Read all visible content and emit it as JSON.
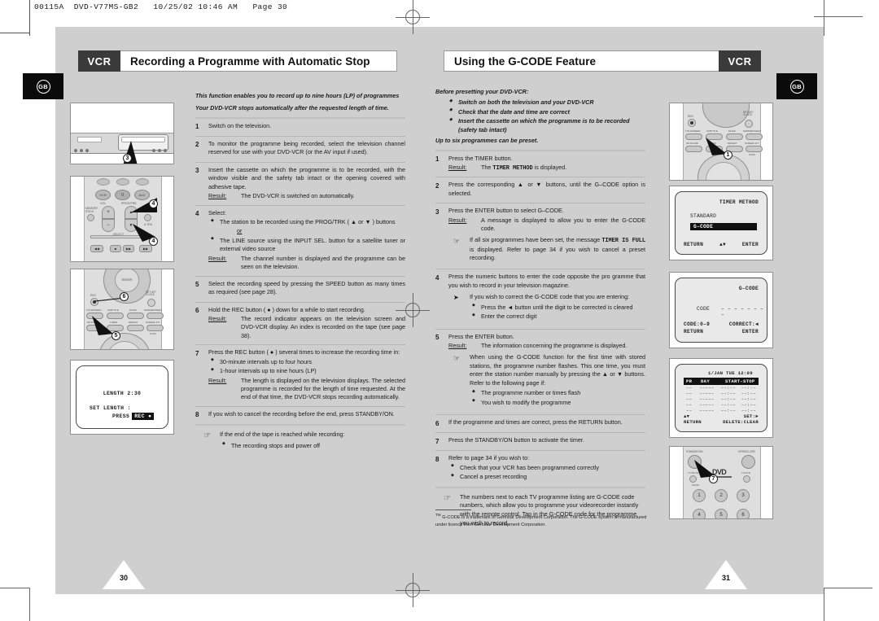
{
  "print_header": {
    "file_line": "00115A  DVD-V77MS-GB2   10/25/02 10:46 AM   Page 30"
  },
  "language_badge": "GB",
  "left_page": {
    "page_number": "30",
    "titlebar": {
      "badge": "VCR",
      "title": "Recording a Programme with Automatic Stop"
    },
    "intro": [
      "This function enables you to record up to nine hours (LP) of programmes",
      "Your DVD-VCR stops automatically after the requested length of time."
    ],
    "steps": [
      {
        "num": "1",
        "lines": [
          "Switch on the television."
        ]
      },
      {
        "num": "2",
        "lines": [
          "To monitor the programme being recorded, select the television channel reserved for use with your DVD-VCR (or the AV input if used)."
        ]
      },
      {
        "num": "3",
        "lines": [
          "Insert the cassette on which the programme is to be recorded, with the window visible and the safety tab intact or the opening covered with adhesive tape."
        ],
        "result": {
          "label": "Result:",
          "text": "The DVD-VCR is switched on automatically."
        }
      },
      {
        "num": "4",
        "lines": [
          "Select:"
        ],
        "bullets": [
          "The station to be recorded using the PROG/TRK ( ▲ or ▼ ) buttons"
        ],
        "or_text": "or",
        "bullets2": [
          "The LINE source using the INPUT SEL. button for a satellite tuner or external video source"
        ],
        "result": {
          "label": "Result:",
          "text": "The channel number is displayed and the programme can be seen on the television."
        }
      },
      {
        "num": "5",
        "lines": [
          "Select the recording speed by pressing the SPEED button as many times as required (see page 28)."
        ]
      },
      {
        "num": "6",
        "lines": [
          "Hold the REC button ( ● ) down for a while to start recording."
        ],
        "result": {
          "label": "Result:",
          "text": "The record indicator appears on the television screen and DVD-VCR display. An index is recorded on the tape (see page 38)."
        }
      },
      {
        "num": "7",
        "lines": [
          "Press the REC button ( ● ) several times to increase the recording time in:"
        ],
        "bullets": [
          "30-minute intervals up to four hours",
          "1-hour intervals up to nine hours (LP)"
        ],
        "result": {
          "label": "Result:",
          "text": "The length is displayed on the television displays. The selected programme is recorded for the length of time requested. At the end of that time, the DVD-VCR stops recording automatically."
        }
      },
      {
        "num": "8",
        "lines": [
          "If you wish to cancel the recording before the end, press STANDBY/ON."
        ]
      }
    ],
    "final_note": {
      "icon": "pointing-hand-icon",
      "text": "If the end of the tape is reached while recording:",
      "bullets": [
        "The recording stops and power off"
      ]
    },
    "illustrations": {
      "deck": {
        "name": "dvd-vcr-deck-illustration",
        "callout": "3"
      },
      "remote_prog": {
        "name": "remote-prog-trk-illustration",
        "callouts": [
          "4",
          "4"
        ],
        "labels": [
          "VOL",
          "PROG/TRK",
          "MEMORY STICK",
          "INPUT SEL.",
          "A.TRK",
          "SELECT",
          "VCR",
          "0",
          "AUX"
        ]
      },
      "remote_rec": {
        "name": "remote-rec-speed-illustration",
        "callouts": [
          "6",
          "5"
        ],
        "labels": [
          "ENTER",
          "REC",
          "SET UP/CLOCK",
          "TITLE/SPEED",
          "SUBTITLE",
          "MODE",
          "MARKER/INDEX",
          "3D SOUND",
          "TIMER",
          "REPEAT",
          "SCREEN FIT",
          "SVHS"
        ]
      },
      "osd_length": {
        "name": "osd-length-screen",
        "line1": "LENGTH 2:30",
        "line2": "SET LENGTH :",
        "line3_pre": "PRESS",
        "line3_key": "REC ●"
      }
    }
  },
  "right_page": {
    "page_number": "31",
    "titlebar": {
      "badge": "VCR",
      "title": "Using the G-CODE  Feature"
    },
    "intro_heading": "Before presetting your DVD-VCR:",
    "intro_bullets": [
      "Switch on both the television and your DVD-VCR",
      "Check that the date and time are correct",
      "Insert the cassette on which the programme is to be recorded (safety tab intact)"
    ],
    "intro_tail": "Up to six programmes can be preset.",
    "steps": [
      {
        "num": "1",
        "lines": [
          "Press the TIMER button."
        ],
        "result": {
          "label": "Result:",
          "text_pre": "The ",
          "mono": "TIMER METHOD",
          "text_post": " is displayed."
        }
      },
      {
        "num": "2",
        "lines": [
          "Press the corresponding ▲ or ▼ buttons, until the G–CODE option is selected."
        ]
      },
      {
        "num": "3",
        "lines": [
          "Press the ENTER button to select G–CODE."
        ],
        "result": {
          "label": "Result:",
          "text": "A message is displayed to allow you to enter the G-CODE code."
        },
        "note": {
          "icon": "pointing-hand-icon",
          "text_pre": "If all six programmes have been set, the message ",
          "mono": "TIMER IS FULL",
          "text_post": " is displayed. Refer to page 34 if you wish to cancel a preset recording."
        }
      },
      {
        "num": "4",
        "lines": [
          "Press the numeric buttons to enter the code opposite the pro gramme that you wish to record in your television magazine."
        ],
        "note2": {
          "icon": "arrow-bullet-icon",
          "text": "If you wish to correct the G-CODE code that you are entering:",
          "bullets": [
            "Press the ◄ button until the digit to be corrected is cleared",
            "Enter the correct digit"
          ]
        }
      },
      {
        "num": "5",
        "lines": [
          "Press the ENTER button."
        ],
        "result": {
          "label": "Result:",
          "text": "The information concerning the programme is displayed."
        },
        "note": {
          "icon": "pointing-hand-icon",
          "text": "When using the G-CODE function for the first time with stored stations, the programme number flashes. This one time, you must enter the station number manually by pressing the ▲ or ▼ buttons. Refer to the following page if:",
          "bullets": [
            "The programme number or times flash",
            "You wish to modify the programme"
          ]
        }
      },
      {
        "num": "6",
        "lines": [
          "If the programme and times are correct, press the RETURN button."
        ]
      },
      {
        "num": "7",
        "lines": [
          "Press the STANDBY/ON button to activate the timer."
        ]
      },
      {
        "num": "8",
        "lines": [
          "Refer to page 34 if you wish to:"
        ],
        "bullets": [
          "Check that your VCR has been programmed correctly",
          "Cancel a preset recording"
        ]
      }
    ],
    "final_note": {
      "icon": "pointing-hand-icon",
      "text": "The numbers next to each TV programme listing are G-CODE code numbers, which allow you to programme your videorecorder instantly with the remote control. Tap in the G-CODE code for the programme you wish to record."
    },
    "footnote": "G-CODE is a trademark of Gemstar Development Corporation. The G-CODE system is manufactured under licence from Gemstar Development Corporation.",
    "footnote_sup": "TM",
    "illustrations": {
      "remote_timer": {
        "name": "remote-timer-button-illustration",
        "callout": "1",
        "labels": [
          "REC",
          "SET UP/CLOCK",
          "TITLE/SPEED",
          "SUBTITLE",
          "MODE",
          "MARKER/INDEX",
          "3D SOUND",
          "TIMER",
          "REPEAT",
          "SCREEN FIT",
          "SVHS"
        ]
      },
      "osd_timer_method": {
        "name": "osd-timer-method-screen",
        "title": "TIMER METHOD",
        "option1": "STANDARD",
        "option2_selected": "G–CODE",
        "foot_left": "RETURN",
        "foot_mid": "▲▼",
        "foot_right": "ENTER"
      },
      "osd_gcode": {
        "name": "osd-gcode-entry-screen",
        "title": "G–CODE",
        "code_label": "CODE",
        "code_value": "– – – – – – – –",
        "foot_l1": "CODE:0–9",
        "foot_l2": "RETURN",
        "foot_r1": "CORRECT:◄",
        "foot_r2": "ENTER"
      },
      "osd_timer_table": {
        "name": "osd-timer-list-screen",
        "clock": "1/JAN TUE  12:09",
        "headers": [
          "PR",
          "DAY",
          "START–STOP"
        ],
        "rows": [
          [
            "––",
            "–––––",
            "––:––",
            "––:––"
          ],
          [
            "––",
            "–––––",
            "––:––",
            "––:––"
          ],
          [
            "––",
            "–––––",
            "––:––",
            "––:––"
          ],
          [
            "––",
            "–––––",
            "––:––",
            "––:––"
          ],
          [
            "––",
            "–––––",
            "––:––",
            "––:––"
          ]
        ],
        "foot_l1": "▲▼",
        "foot_l2": "RETURN",
        "foot_r1": "SET:►",
        "foot_r2": "DELETE:CLEAR"
      },
      "remote_standby": {
        "name": "remote-standby-on-illustration",
        "callout": "7",
        "labels": [
          "STANDBY/ON",
          "OPEN/CLOSE",
          "TV MUTE",
          "ZOOM",
          "TV/VCR",
          "DVD",
          "1",
          "2",
          "3",
          "4",
          "5",
          "6"
        ]
      }
    }
  },
  "colors": {
    "board": "#cfcfcf",
    "badge": "#3a3a3a",
    "tab": "#0b0b0b",
    "rule": "#b4b4b4"
  }
}
